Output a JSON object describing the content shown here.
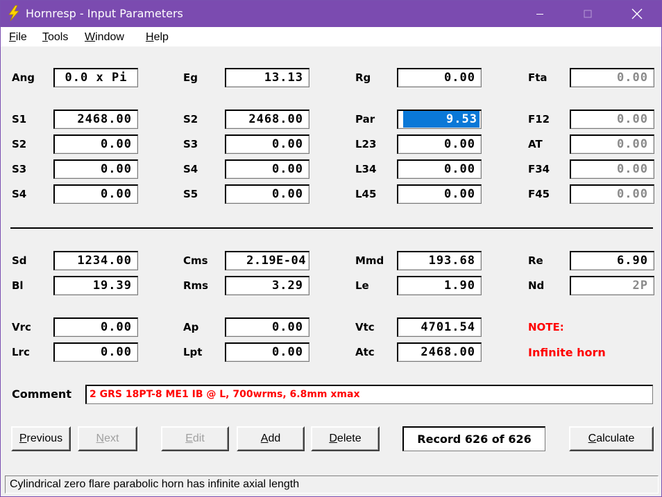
{
  "window": {
    "title": "Hornresp - Input Parameters"
  },
  "menu": [
    {
      "acc": "F",
      "rest": "ile"
    },
    {
      "acc": "T",
      "rest": "ools"
    },
    {
      "acc": "W",
      "rest": "indow"
    },
    {
      "acc": "H",
      "rest": "elp"
    }
  ],
  "params": {
    "ang": {
      "label": "Ang",
      "value": "0.0 x Pi"
    },
    "eg": {
      "label": "Eg",
      "value": "13.13"
    },
    "rg": {
      "label": "Rg",
      "value": "0.00"
    },
    "fta": {
      "label": "Fta",
      "value": "0.00"
    },
    "s1": {
      "label": "S1",
      "value": "2468.00"
    },
    "s2": {
      "label": "S2",
      "value": "2468.00"
    },
    "par": {
      "label": "Par",
      "value": "9.53"
    },
    "f12": {
      "label": "F12",
      "value": "0.00"
    },
    "s2b": {
      "label": "S2",
      "value": "0.00"
    },
    "s3": {
      "label": "S3",
      "value": "0.00"
    },
    "l23": {
      "label": "L23",
      "value": "0.00"
    },
    "at": {
      "label": "AT",
      "value": "0.00"
    },
    "s3b": {
      "label": "S3",
      "value": "0.00"
    },
    "s4": {
      "label": "S4",
      "value": "0.00"
    },
    "l34": {
      "label": "L34",
      "value": "0.00"
    },
    "f34": {
      "label": "F34",
      "value": "0.00"
    },
    "s4b": {
      "label": "S4",
      "value": "0.00"
    },
    "s5": {
      "label": "S5",
      "value": "0.00"
    },
    "l45": {
      "label": "L45",
      "value": "0.00"
    },
    "f45": {
      "label": "F45",
      "value": "0.00"
    },
    "sd": {
      "label": "Sd",
      "value": "1234.00"
    },
    "cms": {
      "label": "Cms",
      "value": "2.19E-04"
    },
    "mmd": {
      "label": "Mmd",
      "value": "193.68"
    },
    "re": {
      "label": "Re",
      "value": "6.90"
    },
    "bl": {
      "label": "Bl",
      "value": "19.39"
    },
    "rms": {
      "label": "Rms",
      "value": "3.29"
    },
    "le": {
      "label": "Le",
      "value": "1.90"
    },
    "nd": {
      "label": "Nd",
      "value": "2P"
    },
    "vrc": {
      "label": "Vrc",
      "value": "0.00"
    },
    "ap": {
      "label": "Ap",
      "value": "0.00"
    },
    "vtc": {
      "label": "Vtc",
      "value": "4701.54"
    },
    "lrc": {
      "label": "Lrc",
      "value": "0.00"
    },
    "lpt": {
      "label": "Lpt",
      "value": "0.00"
    },
    "atc": {
      "label": "Atc",
      "value": "2468.00"
    }
  },
  "note": {
    "label": "NOTE:",
    "text": "Infinite horn"
  },
  "comment": {
    "label": "Comment",
    "value": "2 GRS 18PT-8 ME1 IB @ L, 700wrms, 6.8mm xmax"
  },
  "buttons": {
    "previous": {
      "acc": "P",
      "rest": "revious"
    },
    "next": {
      "acc": "N",
      "rest": "ext"
    },
    "edit": {
      "acc": "E",
      "rest": "dit"
    },
    "add": {
      "acc": "A",
      "rest": "dd"
    },
    "delete": {
      "acc": "D",
      "rest": "elete"
    },
    "calculate": {
      "acc": "C",
      "rest": "alculate"
    }
  },
  "record": "Record 626 of 626",
  "status": "Cylindrical zero flare parabolic horn has infinite axial length",
  "colors": {
    "titlebar": "#7b4bb0",
    "selection": "#0a78d7",
    "note": "#ff0000"
  }
}
